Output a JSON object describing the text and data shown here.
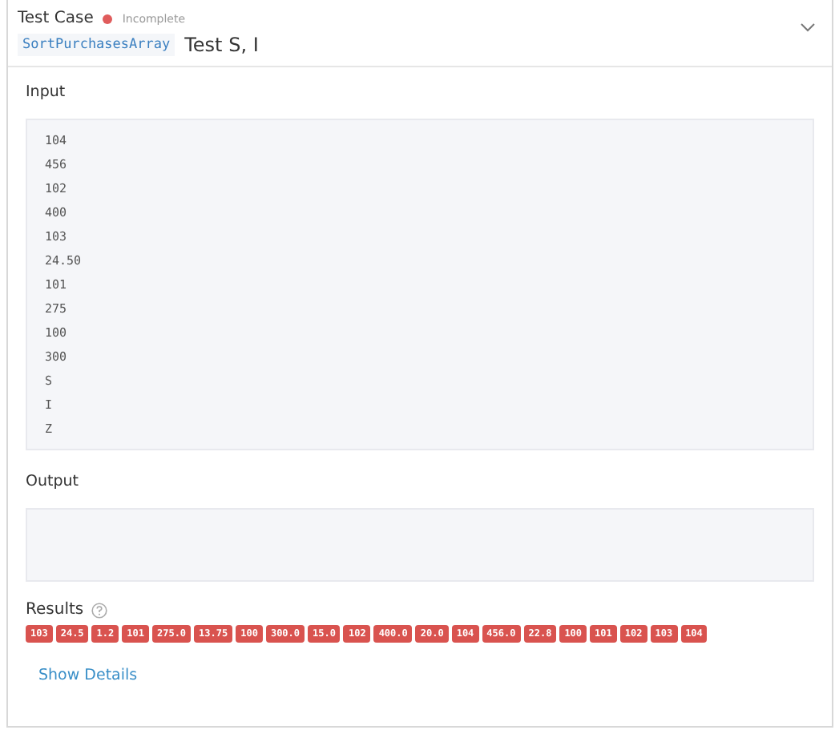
{
  "header": {
    "title": "Test Case",
    "status": {
      "label": "Incomplete",
      "color": "#e05c5c"
    },
    "method": "SortPurchasesArray",
    "name": "Test S, I",
    "expanded": true
  },
  "input": {
    "label": "Input",
    "lines": [
      "104",
      "456",
      "102",
      "400",
      "103",
      "24.50",
      "101",
      "275",
      "100",
      "300",
      "S",
      "I",
      "Z"
    ]
  },
  "output": {
    "label": "Output"
  },
  "results": {
    "label": "Results",
    "badges": [
      {
        "text": "103",
        "passed": false
      },
      {
        "text": "24.5",
        "passed": false
      },
      {
        "text": "1.2",
        "passed": false
      },
      {
        "text": "101",
        "passed": false
      },
      {
        "text": "275.0",
        "passed": false
      },
      {
        "text": "13.75",
        "passed": false
      },
      {
        "text": "100",
        "passed": false
      },
      {
        "text": "300.0",
        "passed": false
      },
      {
        "text": "15.0",
        "passed": false
      },
      {
        "text": "102",
        "passed": false
      },
      {
        "text": "400.0",
        "passed": false
      },
      {
        "text": "20.0",
        "passed": false
      },
      {
        "text": "104",
        "passed": false
      },
      {
        "text": "456.0",
        "passed": false
      },
      {
        "text": "22.8",
        "passed": false
      },
      {
        "text": "100",
        "passed": false
      },
      {
        "text": "101",
        "passed": false
      },
      {
        "text": "102",
        "passed": false
      },
      {
        "text": "103",
        "passed": false
      },
      {
        "text": "104",
        "passed": false
      }
    ]
  },
  "details_link": "Show Details"
}
